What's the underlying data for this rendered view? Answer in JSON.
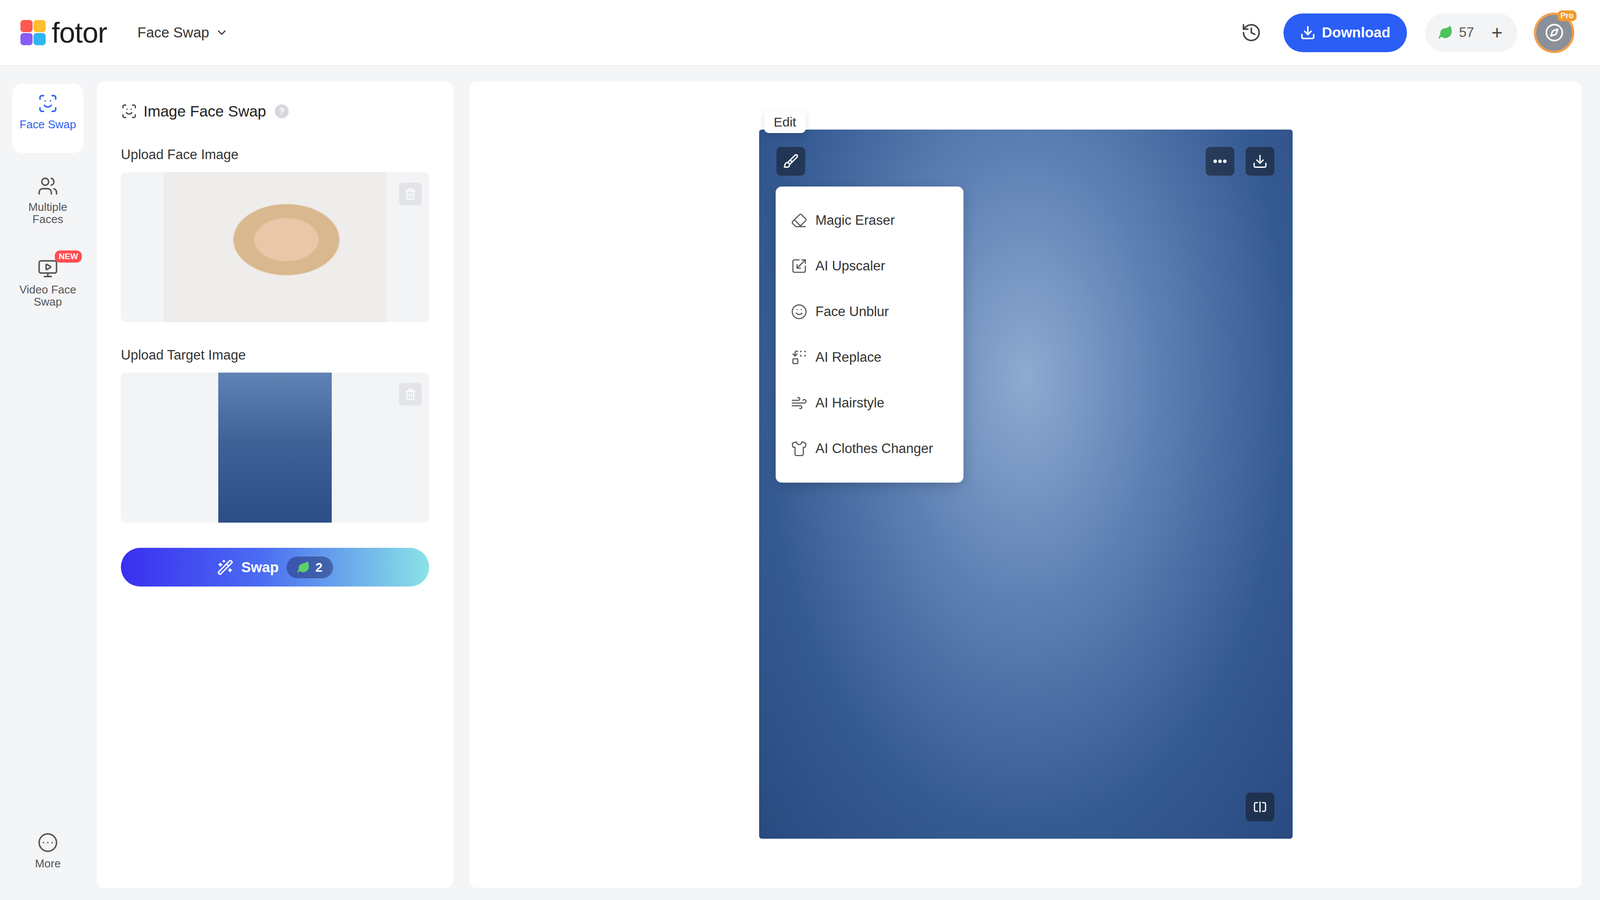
{
  "header": {
    "logo": "fotor",
    "tool": "Face Swap",
    "download": "Download",
    "credits": "57",
    "add": "+",
    "badge": "Pro"
  },
  "sidebar": {
    "items": [
      {
        "label": "Face Swap",
        "selected": true
      },
      {
        "label": "Multiple Faces",
        "selected": false
      },
      {
        "label": "Video Face Swap",
        "selected": false,
        "badge": "NEW"
      }
    ],
    "more": "More"
  },
  "panel": {
    "title": "Image Face Swap",
    "help": "?",
    "uploads": [
      {
        "label": "Upload Face Image"
      },
      {
        "label": "Upload Target Image"
      }
    ],
    "swap": {
      "label": "Swap",
      "cost": "2"
    }
  },
  "canvas": {
    "tooltip": "Edit",
    "menu": {
      "open": true,
      "items": [
        "Magic Eraser",
        "AI Upscaler",
        "Face Unblur",
        "AI Replace",
        "AI Hairstyle",
        "AI Clothes Changer"
      ]
    }
  }
}
